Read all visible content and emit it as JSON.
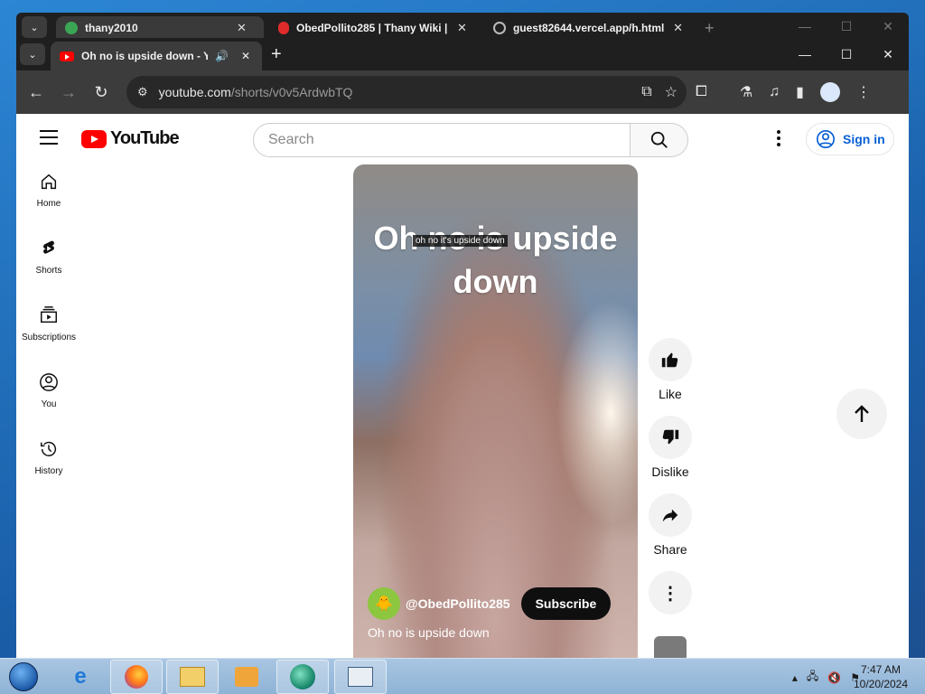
{
  "back_window": {
    "tabs": [
      {
        "title": "thany2010",
        "close": "✕"
      },
      {
        "title": "ObedPollito285 | Thany Wiki |",
        "close": "✕"
      },
      {
        "title": "guest82644.vercel.app/h.html",
        "close": "✕"
      }
    ],
    "new_tab": "+"
  },
  "browser": {
    "tab_title": "Oh no is upside down - Yo",
    "tab_close": "✕",
    "new_tab": "+",
    "url_host": "youtube.com",
    "url_path": "/shorts/v0v5ArdwbTQ",
    "window_controls": {
      "minimize": "—",
      "maximize": "☐",
      "close": "✕"
    }
  },
  "youtube": {
    "logo_text": "YouTube",
    "search_placeholder": "Search",
    "sign_in": "Sign in",
    "sidebar": [
      {
        "label": "Home",
        "icon": "home-icon"
      },
      {
        "label": "Shorts",
        "icon": "shorts-icon"
      },
      {
        "label": "Subscriptions",
        "icon": "subscriptions-icon"
      },
      {
        "label": "You",
        "icon": "you-icon"
      },
      {
        "label": "History",
        "icon": "history-icon"
      }
    ],
    "short": {
      "overlay_title": "Oh no is upside down",
      "caption": "oh no it's upside down",
      "channel": "@ObedPollito285",
      "subscribe": "Subscribe",
      "description": "Oh no is upside down"
    },
    "actions": {
      "like": "Like",
      "dislike": "Dislike",
      "share": "Share"
    }
  },
  "taskbar": {
    "time": "7:47 AM",
    "date": "10/20/2024"
  },
  "colors": {
    "yt_red": "#ff0000",
    "link_blue": "#065fd4",
    "chrome_dark": "#3c3c3c"
  }
}
